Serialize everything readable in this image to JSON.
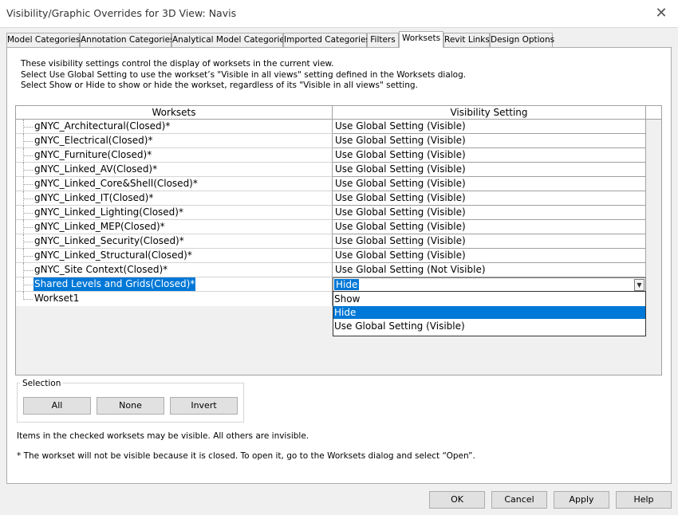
{
  "window": {
    "title": "Visibility/Graphic Overrides for 3D View: Navis",
    "close_icon": "close-icon"
  },
  "tabs": [
    {
      "label": "Model Categories",
      "active": false
    },
    {
      "label": "Annotation Categories",
      "active": false
    },
    {
      "label": "Analytical Model Categories",
      "active": false
    },
    {
      "label": "Imported Categories",
      "active": false
    },
    {
      "label": "Filters",
      "active": false
    },
    {
      "label": "Worksets",
      "active": true
    },
    {
      "label": "Revit Links",
      "active": false
    },
    {
      "label": "Design Options",
      "active": false
    }
  ],
  "description": [
    "These visibility settings control the display of worksets in the current view.",
    "Select Use Global Setting to use the workset’s \"Visible in all views\" setting defined in the Worksets dialog.",
    "Select Show or Hide to show or hide the workset, regardless of its \"Visible in all views\" setting."
  ],
  "table": {
    "headers": [
      "Worksets",
      "Visibility Setting"
    ],
    "rows": [
      {
        "name": "gNYC_Architectural(Closed)*",
        "setting": "Use Global Setting (Visible)"
      },
      {
        "name": "gNYC_Electrical(Closed)*",
        "setting": "Use Global Setting (Visible)"
      },
      {
        "name": "gNYC_Furniture(Closed)*",
        "setting": "Use Global Setting (Visible)"
      },
      {
        "name": "gNYC_Linked_AV(Closed)*",
        "setting": "Use Global Setting (Visible)"
      },
      {
        "name": "gNYC_Linked_Core&Shell(Closed)*",
        "setting": "Use Global Setting (Visible)"
      },
      {
        "name": "gNYC_Linked_IT(Closed)*",
        "setting": "Use Global Setting (Visible)"
      },
      {
        "name": "gNYC_Linked_Lighting(Closed)*",
        "setting": "Use Global Setting (Visible)"
      },
      {
        "name": "gNYC_Linked_MEP(Closed)*",
        "setting": "Use Global Setting (Visible)"
      },
      {
        "name": "gNYC_Linked_Security(Closed)*",
        "setting": "Use Global Setting (Visible)"
      },
      {
        "name": "gNYC_Linked_Structural(Closed)*",
        "setting": "Use Global Setting (Visible)"
      },
      {
        "name": "gNYC_Site Context(Closed)*",
        "setting": "Use Global Setting (Not Visible)"
      },
      {
        "name": "Shared Levels and Grids(Closed)*",
        "setting": "Hide",
        "selected": true
      },
      {
        "name": "Workset1",
        "setting": ""
      }
    ],
    "dropdown_options": [
      "Show",
      "Hide",
      "Use Global Setting (Visible)"
    ],
    "dropdown_highlighted": "Hide"
  },
  "selection": {
    "legend": "Selection",
    "all_label": "All",
    "none_label": "None",
    "invert_label": "Invert"
  },
  "notes": {
    "checked": "Items in the checked worksets may be visible.  All others are invisible.",
    "closed": "* The workset will not be visible because it is closed. To open it, go to the Worksets dialog and select “Open”."
  },
  "buttons": {
    "ok": "OK",
    "cancel": "Cancel",
    "apply": "Apply",
    "help": "Help"
  },
  "colors": {
    "selection_blue": "#0078d7"
  }
}
